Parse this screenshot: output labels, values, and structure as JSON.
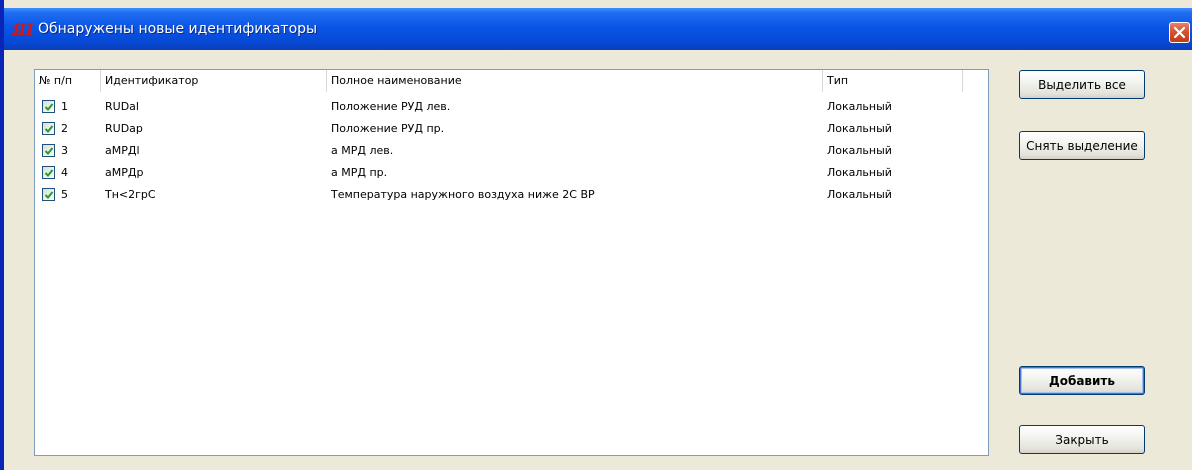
{
  "window": {
    "title": "Обнаружены новые идентификаторы",
    "icon": "app-logo-icon",
    "close_icon": "close-icon"
  },
  "list": {
    "columns": [
      "№ п/п",
      "Идентификатор",
      "Полное наименование",
      "Тип"
    ],
    "rows": [
      {
        "checked": true,
        "num": "1",
        "id": "RUDal",
        "name": "Положение РУД лев.",
        "type": "Локальный"
      },
      {
        "checked": true,
        "num": "2",
        "id": "RUDap",
        "name": "Положение РУД пр.",
        "type": "Локальный"
      },
      {
        "checked": true,
        "num": "3",
        "id": "aМРДl",
        "name": "a МРД лев.",
        "type": "Локальный"
      },
      {
        "checked": true,
        "num": "4",
        "id": "aМРДp",
        "name": "a МРД пр.",
        "type": "Локальный"
      },
      {
        "checked": true,
        "num": "5",
        "id": "Тн<2грС",
        "name": "Температура наружного воздуха ниже 2С ВР",
        "type": "Локальный"
      }
    ]
  },
  "buttons": {
    "select_all": "Выделить все",
    "deselect": "Снять выделение",
    "add": "Добавить",
    "close": "Закрыть"
  },
  "colors": {
    "titlebar": "#0a55e6",
    "close_button": "#d8532f",
    "dialog_bg": "#ece9d8",
    "checkmark": "#21a121"
  }
}
